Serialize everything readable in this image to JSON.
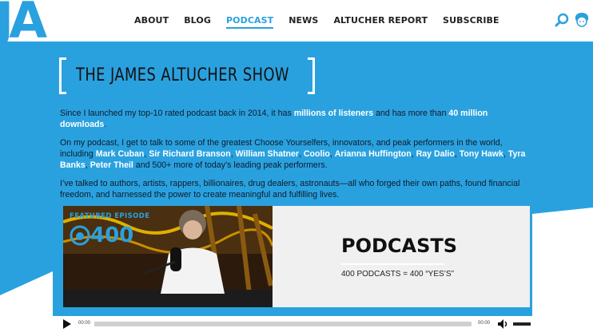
{
  "brand": {
    "logo": "JA"
  },
  "nav": [
    "ABOUT",
    "BLOG",
    "PODCAST",
    "NEWS",
    "ALTUCHER REPORT",
    "SUBSCRIBE"
  ],
  "active_nav": "PODCAST",
  "icons": {
    "search": "search-icon",
    "avatar": "avatar"
  },
  "colors": {
    "accent": "#2aa1df",
    "text": "#0d1b2a"
  },
  "show": {
    "title": "THE JAMES ALTUCHER SHOW"
  },
  "intro": {
    "p1_a": "Since I launched my top-10 rated podcast back in 2014, it has ",
    "p1_b": "millions of listeners",
    "p1_c": " and has more than ",
    "p1_d": "40 million downloads",
    "p1_e": ".",
    "p2_a": "On my podcast, I get to talk to some of the greatest Choose Yourselfers, innovators, and peak performers in the world, including ",
    "guests": [
      "Mark Cuban",
      "Sir Richard Branson",
      "William Shatner",
      "Coolio",
      "Arianna Huffington",
      "Ray Dalio",
      "Tony Hawk",
      "Tyra Banks",
      "Peter Theil"
    ],
    "p2_z": " and 500+ more of today’s leading peak performers.",
    "p3": "I’ve talked to authors, artists, rappers, billionaires, drug dealers, astronauts—all who forged their own paths, found financial freedom, and harnessed the power to create meaningful and fulfilling lives."
  },
  "card": {
    "featured": "FEATURED EPISODE",
    "episode": "400",
    "title": "PODCASTS",
    "subtitle": "400 PODCASTS = 400 “YES’S”"
  },
  "player": {
    "current": "00:00",
    "duration": "00:00",
    "progress": 0
  }
}
